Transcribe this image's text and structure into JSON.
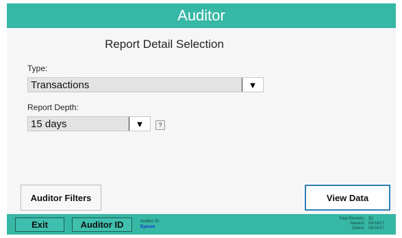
{
  "window": {
    "title": "Auditor"
  },
  "main": {
    "heading": "Report Detail Selection",
    "type": {
      "label": "Type:",
      "value": "Transactions",
      "arrow": "▼"
    },
    "depth": {
      "label": "Report Depth:",
      "value": "15 days",
      "arrow": "▼",
      "help": "?"
    },
    "filters_button": "Auditor Filters",
    "view_button": "View Data"
  },
  "footer": {
    "exit_button": "Exit",
    "auditor_id_button": "Auditor ID",
    "auditor_id_label": "Auditor ID:",
    "auditor_id_value": "Eyecon",
    "stats": [
      {
        "label": "Total Records:",
        "value": "32"
      },
      {
        "label": "Newest:",
        "value": "08/18/17"
      },
      {
        "label": "Oldest:",
        "value": "08/16/17"
      }
    ]
  },
  "colors": {
    "teal": "#37b7a5",
    "primary_border": "#2c80b7",
    "id_value": "#1830d0"
  }
}
